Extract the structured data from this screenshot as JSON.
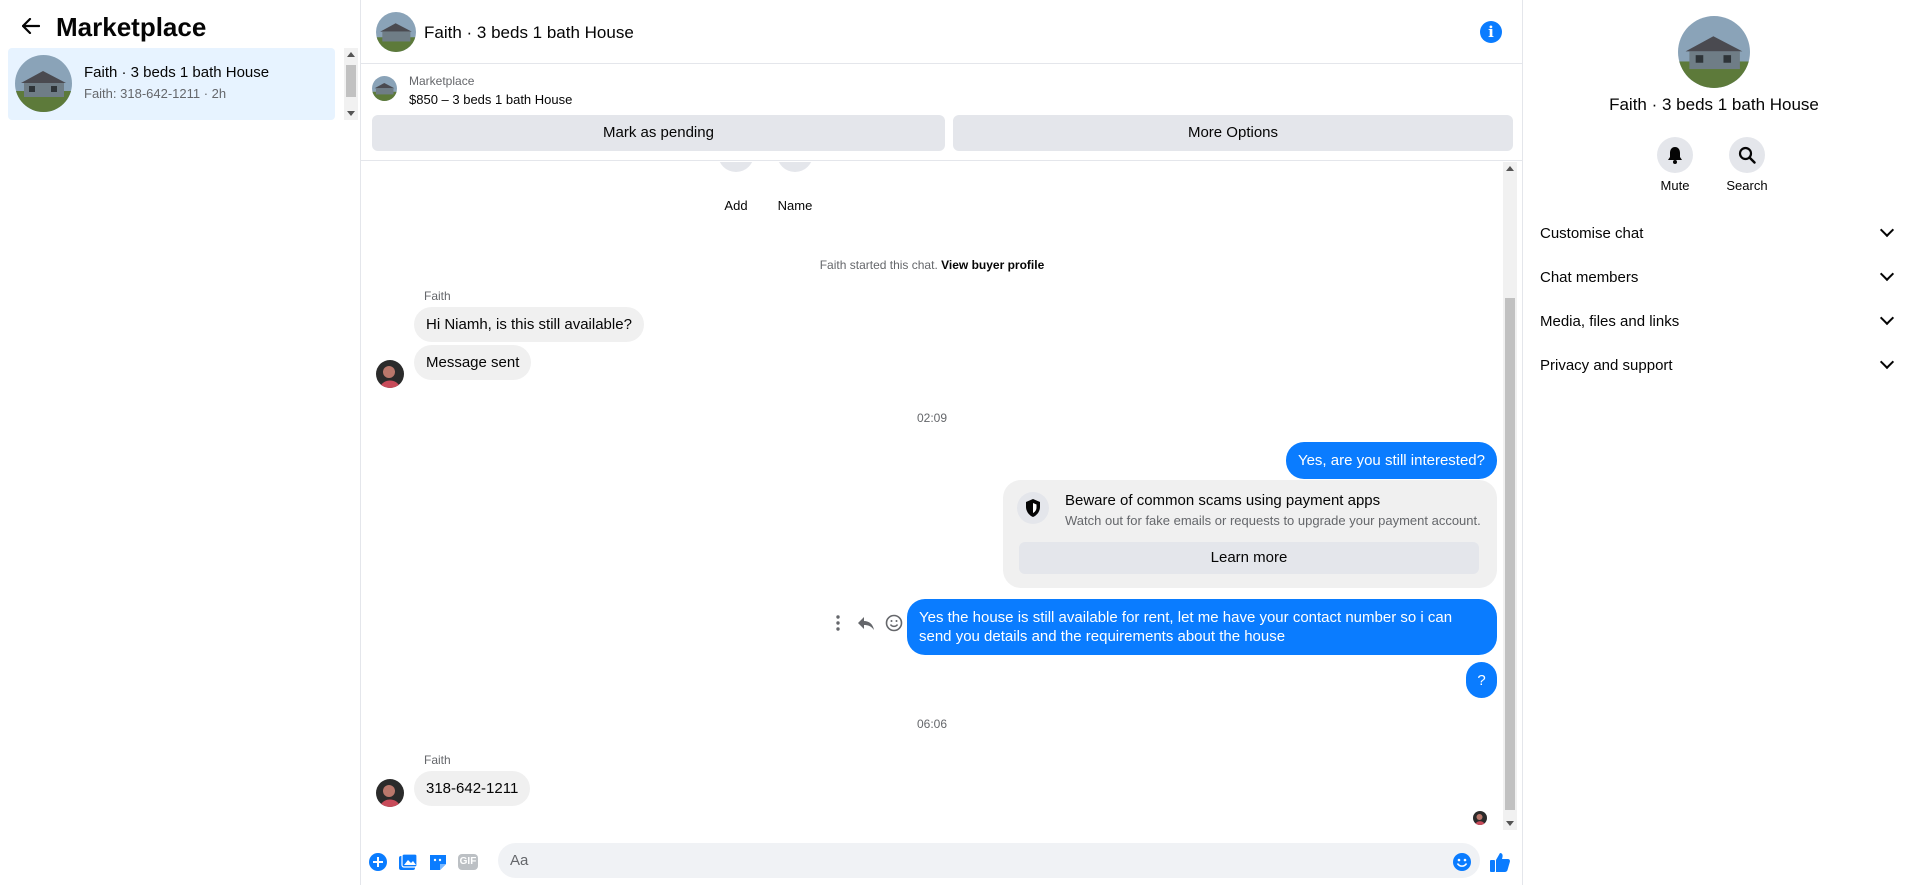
{
  "left_panel": {
    "title": "Marketplace",
    "conversation": {
      "title": "Faith · 3 beds 1 bath House",
      "subtitle": "Faith: 318-642-1211 · 2h"
    }
  },
  "chat_header": {
    "title": "Faith · 3 beds 1 bath House"
  },
  "listing": {
    "label": "Marketplace",
    "title": "$850 – 3 beds 1 bath House",
    "mark_pending": "Mark as pending",
    "more_options": "More Options"
  },
  "messages": {
    "actions": {
      "add": "Add",
      "name": "Name"
    },
    "started_text": "Faith started this chat.",
    "view_profile": "View buyer profile",
    "sender_1": "Faith",
    "msg_1": "Hi Niamh, is this still available?",
    "msg_2": "Message sent",
    "time_1": "02:09",
    "out_1": "Yes, are you still interested?",
    "scam": {
      "title": "Beware of common scams using payment apps",
      "subtitle": "Watch out for fake emails or requests to upgrade your payment account.",
      "button": "Learn more"
    },
    "out_2": "Yes the house is still available for rent, let me have your contact number so i can send you details and the requirements about the house",
    "out_3": "?",
    "time_2": "06:06",
    "sender_2": "Faith",
    "msg_3": "318-642-1211"
  },
  "composer": {
    "placeholder": "Aa",
    "gif": "GIF"
  },
  "right_panel": {
    "title": "Faith · 3 beds 1 bath House",
    "mute": "Mute",
    "search": "Search",
    "sections": [
      "Customise chat",
      "Chat members",
      "Media, files and links",
      "Privacy and support"
    ]
  },
  "colors": {
    "accent": "#0a7cff",
    "selected_bg": "#e7f3ff",
    "bubble_in": "#f0f0f0"
  }
}
